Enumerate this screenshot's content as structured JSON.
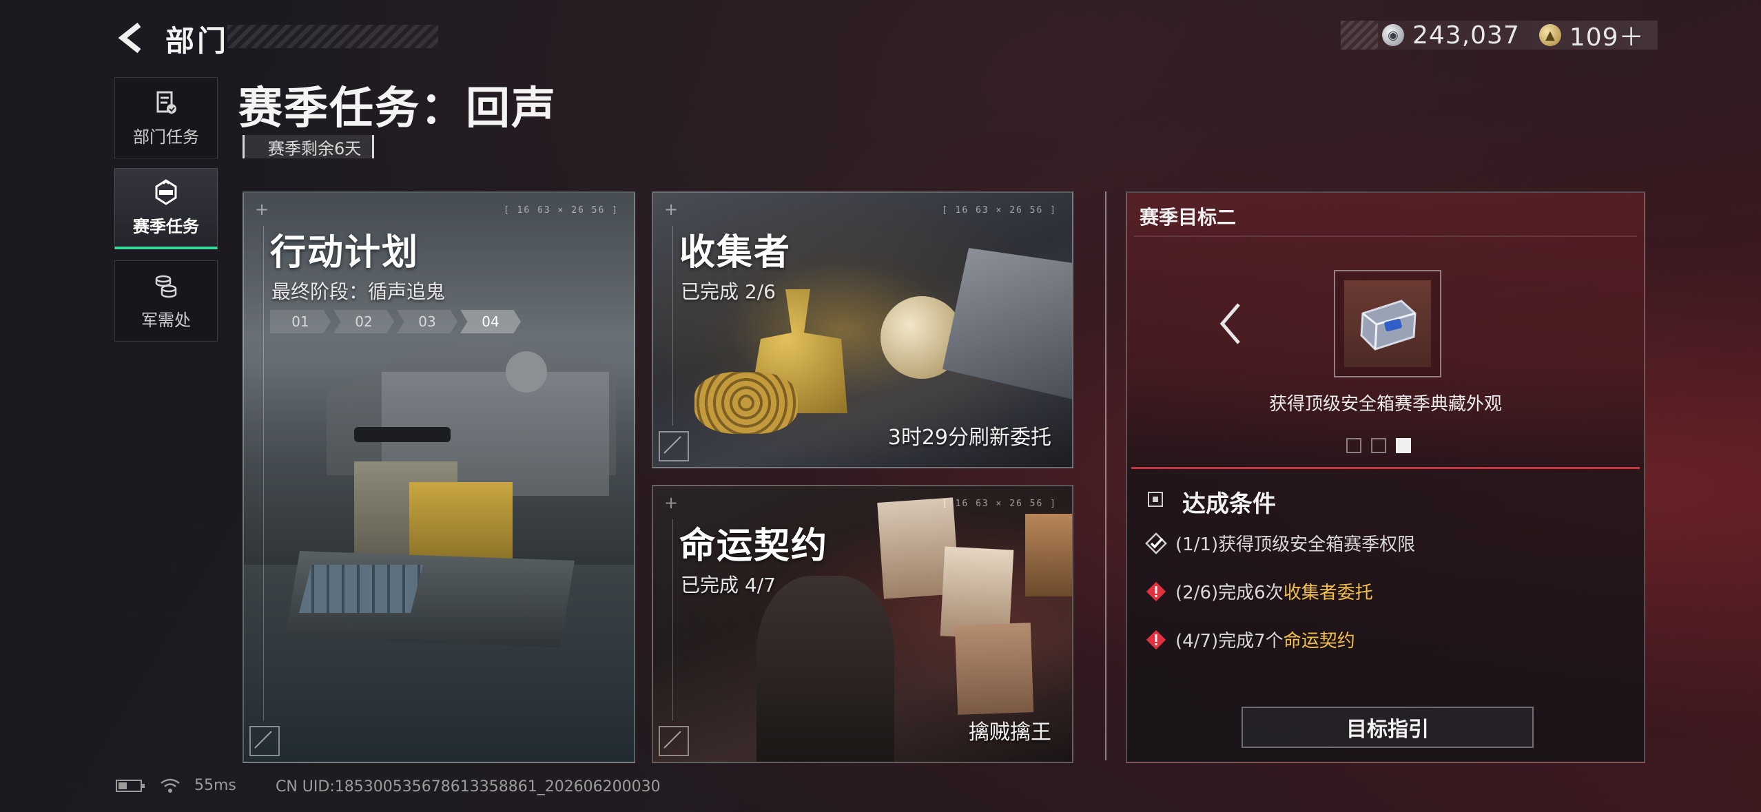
{
  "header": {
    "title": "部门",
    "currency": [
      {
        "icon": "silver-coin-icon",
        "value": "243,037"
      },
      {
        "icon": "gold-coin-icon",
        "value": "109＋"
      }
    ]
  },
  "sidebar": {
    "items": [
      {
        "label": "部门任务",
        "icon": "document-icon",
        "active": false
      },
      {
        "label": "赛季任务",
        "icon": "season-emblem-icon",
        "active": true
      },
      {
        "label": "军需处",
        "icon": "coin-stack-icon",
        "active": false
      }
    ]
  },
  "page": {
    "title": "赛季任务：回声",
    "remaining": "赛季剩余6天"
  },
  "cards": {
    "action": {
      "title": "行动计划",
      "subtitle": "最终阶段：循声追鬼",
      "stages": [
        "01",
        "02",
        "03",
        "04"
      ],
      "hud": "[ 16 63 × 26 56 ]"
    },
    "collector": {
      "title": "收集者",
      "progress": "已完成 2/6",
      "refresh": "3时29分刷新委托",
      "hud": "[ 16 63 × 26 56 ]"
    },
    "fate": {
      "title": "命运契约",
      "progress": "已完成 4/7",
      "footer": "擒贼擒王",
      "hud": "[ 16 63 × 26 56 ]"
    }
  },
  "goal_panel": {
    "title": "赛季目标二",
    "reward_desc": "获得顶级安全箱赛季典藏外观",
    "dots_total": 3,
    "dots_active_index": 2,
    "conditions_title": "达成条件",
    "conditions": [
      {
        "status": "done",
        "prefix": "(1/1)获得顶级安全箱赛季权限",
        "highlight": ""
      },
      {
        "status": "pending",
        "prefix": "(2/6)完成6次",
        "highlight": "收集者委托"
      },
      {
        "status": "pending",
        "prefix": "(4/7)完成7个",
        "highlight": "命运契约"
      }
    ],
    "guide_button": "目标指引"
  },
  "status": {
    "ping": "55ms",
    "uid": "CN UID:1853005356786133588​61_202606200030"
  },
  "colors": {
    "accent_green": "#3cd79a",
    "highlight_gold": "#f2c14b",
    "warning_red": "#e2323f"
  }
}
